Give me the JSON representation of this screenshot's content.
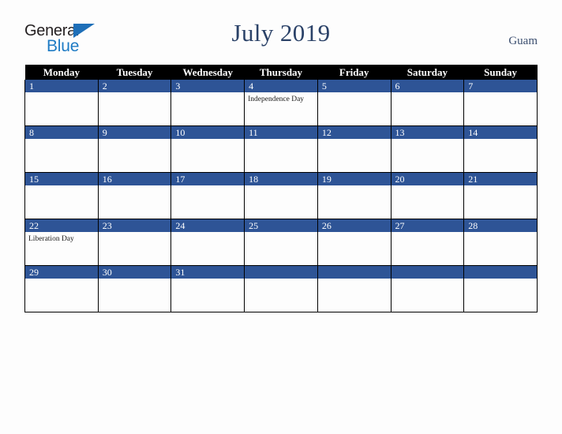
{
  "brand": {
    "name_part1": "General",
    "name_part2": "Blue",
    "triangle_icon": "triangle-icon"
  },
  "header": {
    "title": "July 2019",
    "region": "Guam"
  },
  "calendar": {
    "month": "July",
    "year": "2019",
    "weekday_headers": [
      "Monday",
      "Tuesday",
      "Wednesday",
      "Thursday",
      "Friday",
      "Saturday",
      "Sunday"
    ],
    "colors": {
      "header_background": "#000000",
      "header_text": "#ffffff",
      "daynum_background": "#2e5496",
      "daynum_text": "#ffffff",
      "cell_background": "#fdfdfd",
      "grid_border": "#000000",
      "title_text": "#2b4268",
      "region_text": "#3c4f70",
      "page_background": "#fdfdfd"
    },
    "weeks": [
      [
        {
          "day": "1",
          "event": ""
        },
        {
          "day": "2",
          "event": ""
        },
        {
          "day": "3",
          "event": ""
        },
        {
          "day": "4",
          "event": "Independence Day"
        },
        {
          "day": "5",
          "event": ""
        },
        {
          "day": "6",
          "event": ""
        },
        {
          "day": "7",
          "event": ""
        }
      ],
      [
        {
          "day": "8",
          "event": ""
        },
        {
          "day": "9",
          "event": ""
        },
        {
          "day": "10",
          "event": ""
        },
        {
          "day": "11",
          "event": ""
        },
        {
          "day": "12",
          "event": ""
        },
        {
          "day": "13",
          "event": ""
        },
        {
          "day": "14",
          "event": ""
        }
      ],
      [
        {
          "day": "15",
          "event": ""
        },
        {
          "day": "16",
          "event": ""
        },
        {
          "day": "17",
          "event": ""
        },
        {
          "day": "18",
          "event": ""
        },
        {
          "day": "19",
          "event": ""
        },
        {
          "day": "20",
          "event": ""
        },
        {
          "day": "21",
          "event": ""
        }
      ],
      [
        {
          "day": "22",
          "event": "Liberation Day"
        },
        {
          "day": "23",
          "event": ""
        },
        {
          "day": "24",
          "event": ""
        },
        {
          "day": "25",
          "event": ""
        },
        {
          "day": "26",
          "event": ""
        },
        {
          "day": "27",
          "event": ""
        },
        {
          "day": "28",
          "event": ""
        }
      ],
      [
        {
          "day": "29",
          "event": ""
        },
        {
          "day": "30",
          "event": ""
        },
        {
          "day": "31",
          "event": ""
        },
        {
          "day": "",
          "event": ""
        },
        {
          "day": "",
          "event": ""
        },
        {
          "day": "",
          "event": ""
        },
        {
          "day": "",
          "event": ""
        }
      ]
    ],
    "holidays": [
      {
        "date": "4",
        "name": "Independence Day"
      },
      {
        "date": "22",
        "name": "Liberation Day"
      }
    ]
  }
}
